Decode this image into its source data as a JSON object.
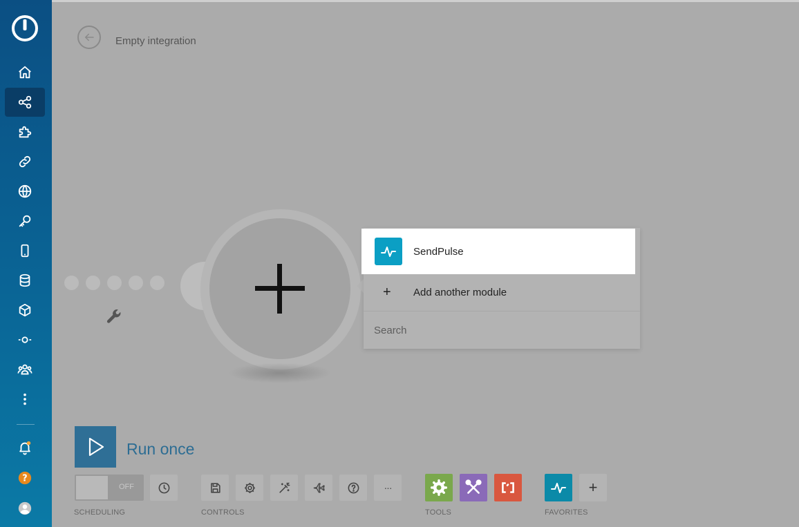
{
  "header": {
    "title": "Empty integration"
  },
  "popup": {
    "app_name": "SendPulse",
    "add_module_label": "Add another module",
    "search_placeholder": "Search"
  },
  "run": {
    "label": "Run once"
  },
  "scheduling": {
    "state_label": "OFF",
    "group_label": "SCHEDULING"
  },
  "controls": {
    "group_label": "CONTROLS",
    "more_label": "···"
  },
  "tools": {
    "group_label": "TOOLS"
  },
  "favorites": {
    "group_label": "FAVORITES",
    "add_label": "+"
  },
  "colors": {
    "sidebar_top": "#0b4f83",
    "sidebar_bottom": "#0b7aa6",
    "run_blue": "#2f6f96",
    "sendpulse": "#0b9fc4",
    "tool_green": "#7aa84c",
    "tool_purple": "#8a6ab8",
    "tool_red": "#d9573f",
    "notification_dot": "#f0a43a",
    "help_orange": "#e8891e"
  }
}
